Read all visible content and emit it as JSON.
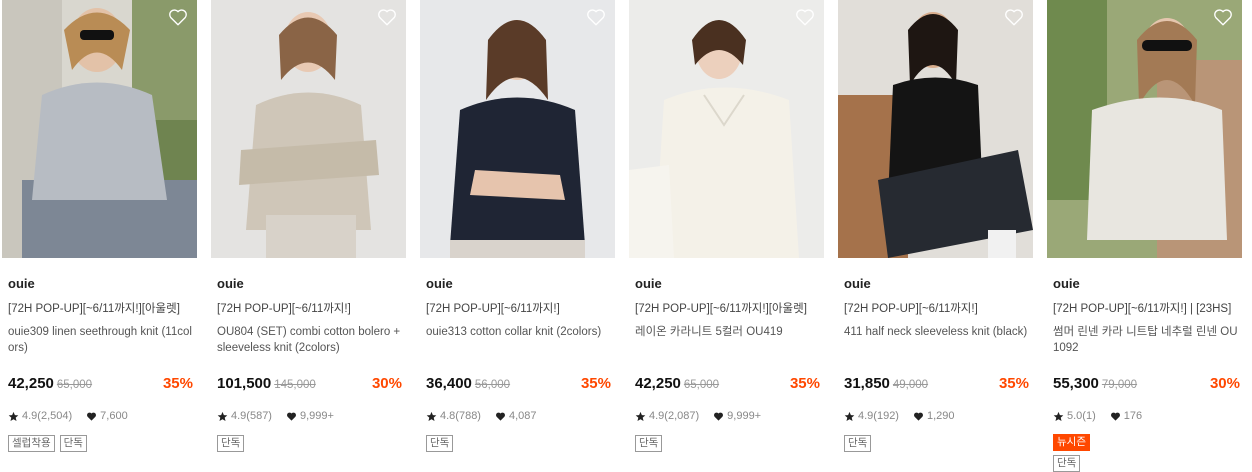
{
  "colors": {
    "discount": "#ff4800",
    "badge_new": "#ff4800"
  },
  "products": [
    {
      "brand": "ouie",
      "promo": "[72H POP-UP][~6/11까지!][아울렛]",
      "name": "ouie309 linen seethrough knit (11colors)",
      "price": "42,250",
      "original_price": "65,000",
      "discount": "35%",
      "rating": "4.9(2,504)",
      "likes": "7,600",
      "tags": [
        "셀럽착용",
        "단독"
      ],
      "heart_icon": "heart-outline-icon"
    },
    {
      "brand": "ouie",
      "promo": "[72H POP-UP][~6/11까지!]",
      "name": "OU804 (SET) combi cotton bolero + sleeveless knit (2colors)",
      "price": "101,500",
      "original_price": "145,000",
      "discount": "30%",
      "rating": "4.9(587)",
      "likes": "9,999+",
      "tags": [
        "단독"
      ],
      "heart_icon": "heart-outline-icon"
    },
    {
      "brand": "ouie",
      "promo": "[72H POP-UP][~6/11까지!]",
      "name": "ouie313 cotton collar knit (2colors)",
      "price": "36,400",
      "original_price": "56,000",
      "discount": "35%",
      "rating": "4.8(788)",
      "likes": "4,087",
      "tags": [
        "단독"
      ],
      "heart_icon": "heart-outline-icon"
    },
    {
      "brand": "ouie",
      "promo": "[72H POP-UP][~6/11까지!][아울렛]",
      "name": "레이온 카라니트 5컬러 OU419",
      "price": "42,250",
      "original_price": "65,000",
      "discount": "35%",
      "rating": "4.9(2,087)",
      "likes": "9,999+",
      "tags": [
        "단독"
      ],
      "heart_icon": "heart-outline-icon"
    },
    {
      "brand": "ouie",
      "promo": "[72H POP-UP][~6/11까지!]",
      "name": "411 half neck sleeveless knit (black)",
      "price": "31,850",
      "original_price": "49,000",
      "discount": "35%",
      "rating": "4.9(192)",
      "likes": "1,290",
      "tags": [
        "단독"
      ],
      "heart_icon": "heart-outline-icon"
    },
    {
      "brand": "ouie",
      "promo": "[72H POP-UP][~6/11까지!] | [23HS]",
      "name": "썸머 린넨 카라 니트탑 네추럴 린넨 OU1092",
      "price": "55,300",
      "original_price": "79,000",
      "discount": "30%",
      "rating": "5.0(1)",
      "likes": "176",
      "tags": [
        "뉴시즌",
        "단독"
      ],
      "heart_icon": "heart-outline-icon"
    }
  ]
}
